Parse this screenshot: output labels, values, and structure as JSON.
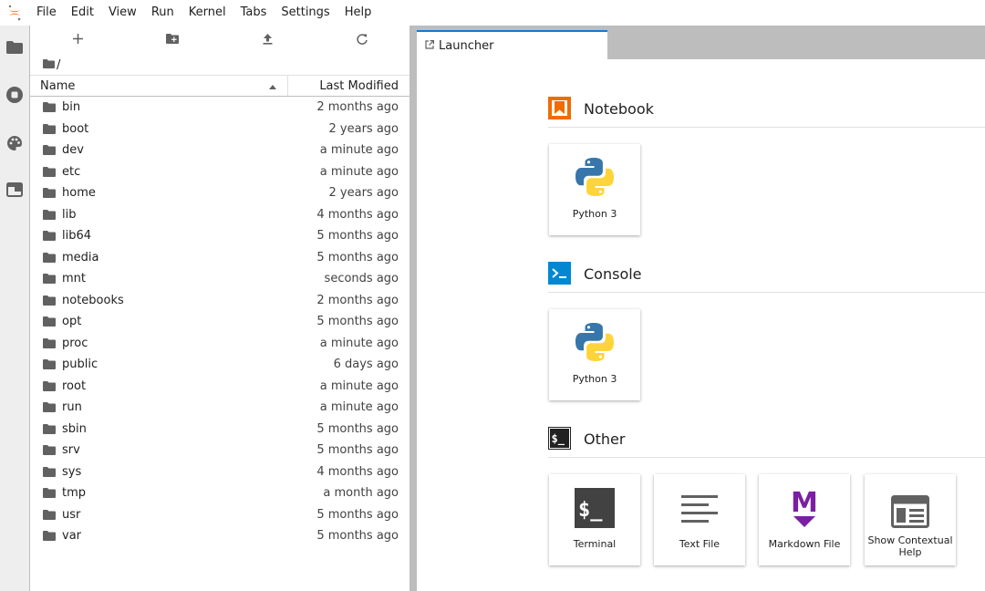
{
  "menubar": {
    "items": [
      "File",
      "Edit",
      "View",
      "Run",
      "Kernel",
      "Tabs",
      "Settings",
      "Help"
    ]
  },
  "activity_bar": {
    "icons": [
      "folder-icon",
      "running-icon",
      "palette-icon",
      "tabs-icon"
    ]
  },
  "filebrowser": {
    "toolbar": [
      "new-launcher-icon",
      "new-folder-icon",
      "upload-icon",
      "refresh-icon"
    ],
    "breadcrumb": "/",
    "columns": {
      "name": "Name",
      "modified": "Last Modified"
    },
    "files": [
      {
        "name": "bin",
        "modified": "2 months ago"
      },
      {
        "name": "boot",
        "modified": "2 years ago"
      },
      {
        "name": "dev",
        "modified": "a minute ago"
      },
      {
        "name": "etc",
        "modified": "a minute ago"
      },
      {
        "name": "home",
        "modified": "2 years ago"
      },
      {
        "name": "lib",
        "modified": "4 months ago"
      },
      {
        "name": "lib64",
        "modified": "5 months ago"
      },
      {
        "name": "media",
        "modified": "5 months ago"
      },
      {
        "name": "mnt",
        "modified": "seconds ago"
      },
      {
        "name": "notebooks",
        "modified": "2 months ago"
      },
      {
        "name": "opt",
        "modified": "5 months ago"
      },
      {
        "name": "proc",
        "modified": "a minute ago"
      },
      {
        "name": "public",
        "modified": "6 days ago"
      },
      {
        "name": "root",
        "modified": "a minute ago"
      },
      {
        "name": "run",
        "modified": "a minute ago"
      },
      {
        "name": "sbin",
        "modified": "5 months ago"
      },
      {
        "name": "srv",
        "modified": "5 months ago"
      },
      {
        "name": "sys",
        "modified": "4 months ago"
      },
      {
        "name": "tmp",
        "modified": "a month ago"
      },
      {
        "name": "usr",
        "modified": "5 months ago"
      },
      {
        "name": "var",
        "modified": "5 months ago"
      }
    ]
  },
  "tabs": [
    {
      "label": "Launcher"
    }
  ],
  "launcher": {
    "notebook": {
      "title": "Notebook",
      "cards": [
        "Python 3"
      ]
    },
    "console": {
      "title": "Console",
      "cards": [
        "Python 3"
      ]
    },
    "other": {
      "title": "Other",
      "cards": [
        "Terminal",
        "Text File",
        "Markdown File",
        "Show Contextual Help"
      ]
    }
  },
  "colors": {
    "accent": "#1976d2",
    "notebook_orange": "#ef6c00",
    "console_blue": "#0288d1",
    "markdown_purple": "#7b1fa2",
    "python_blue": "#3776ab",
    "python_yellow": "#ffd43b"
  }
}
